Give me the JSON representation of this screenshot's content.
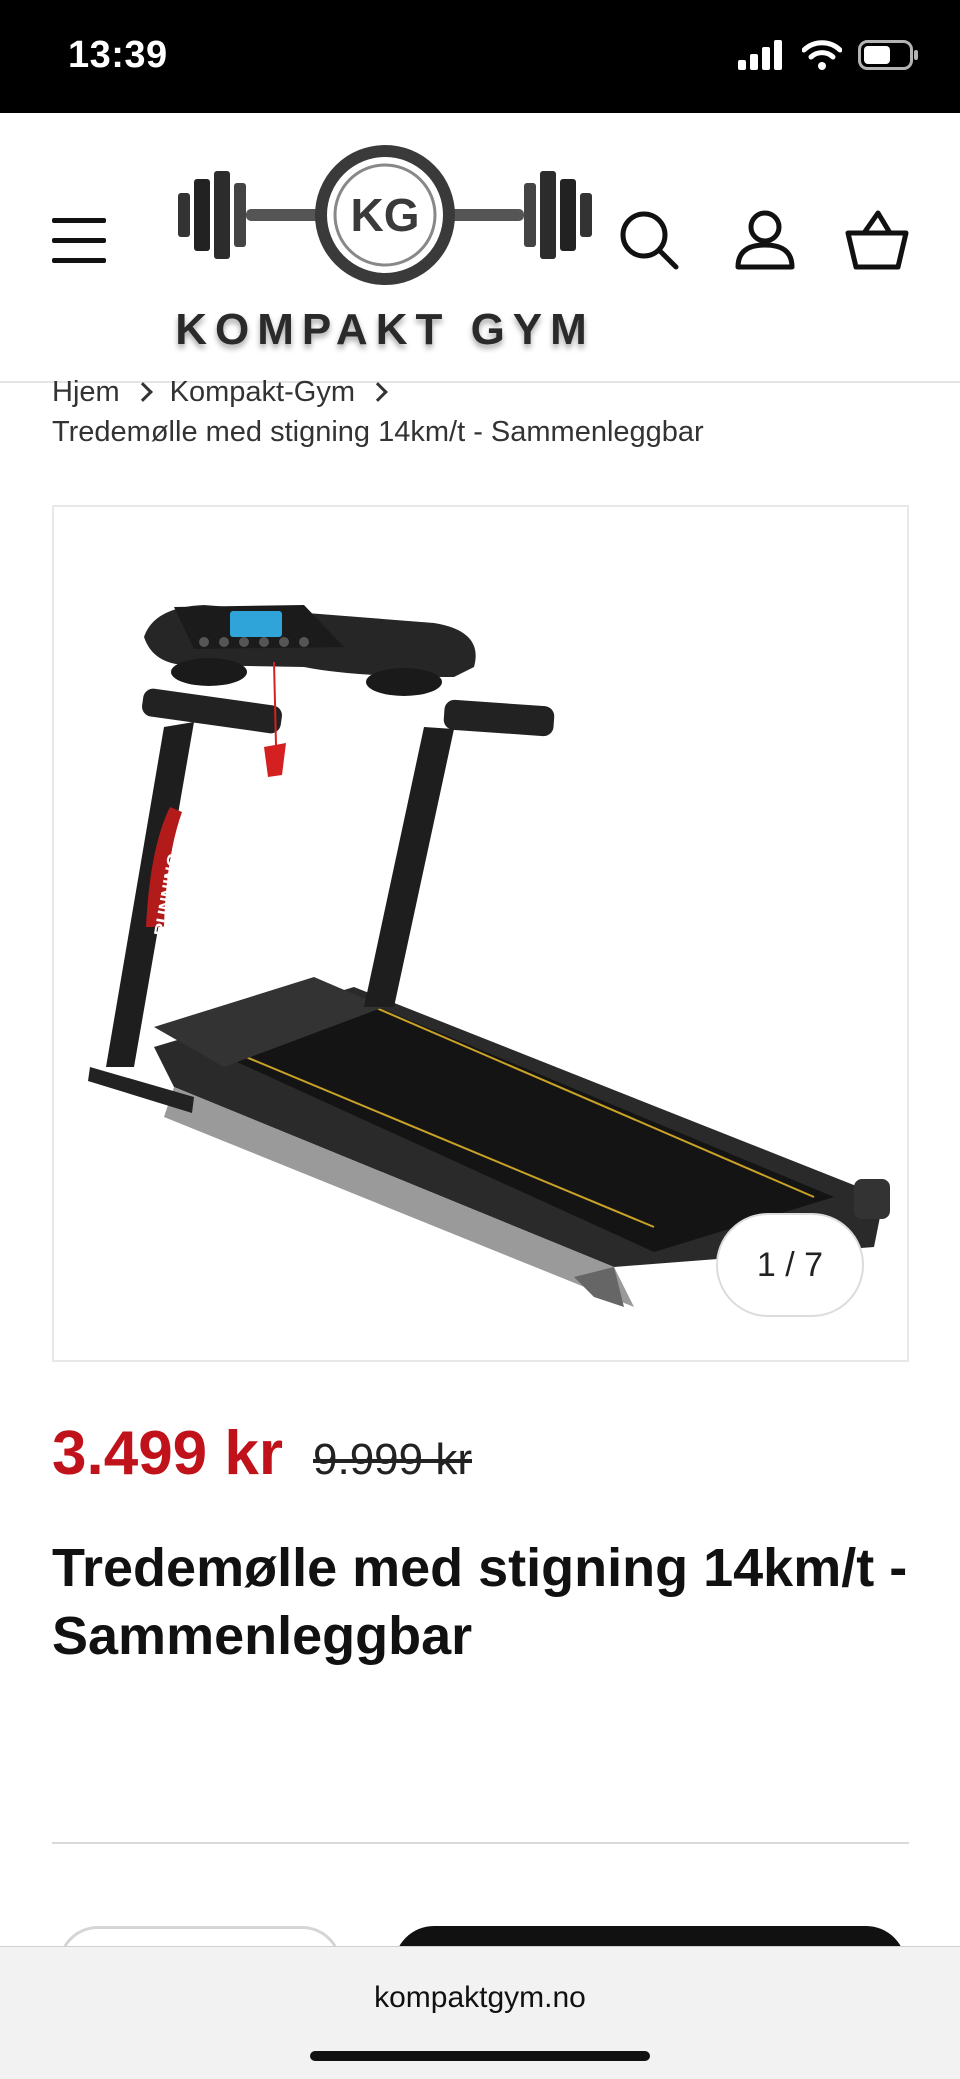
{
  "status_bar": {
    "time": "13:39"
  },
  "header": {
    "logo_text": "KOMPAKT GYM",
    "logo_monogram": "KG",
    "icons": [
      "menu-icon",
      "search-icon",
      "account-icon",
      "cart-icon"
    ]
  },
  "breadcrumb": {
    "items": [
      "Hjem",
      "Kompakt-Gym"
    ],
    "current": "Tredemølle med stigning 14km/t - Sammenleggbar"
  },
  "gallery": {
    "counter": "1 / 7",
    "image_label": "RUNNING"
  },
  "product": {
    "sale_price": "3.499 kr",
    "regular_price": "9.999 kr",
    "title": "Tredemølle med stigning 14km/t - Sammenleggbar"
  },
  "browser": {
    "url": "kompaktgym.no"
  },
  "colors": {
    "sale": "#c0121a",
    "text": "#121212",
    "status_bg": "#000000"
  }
}
